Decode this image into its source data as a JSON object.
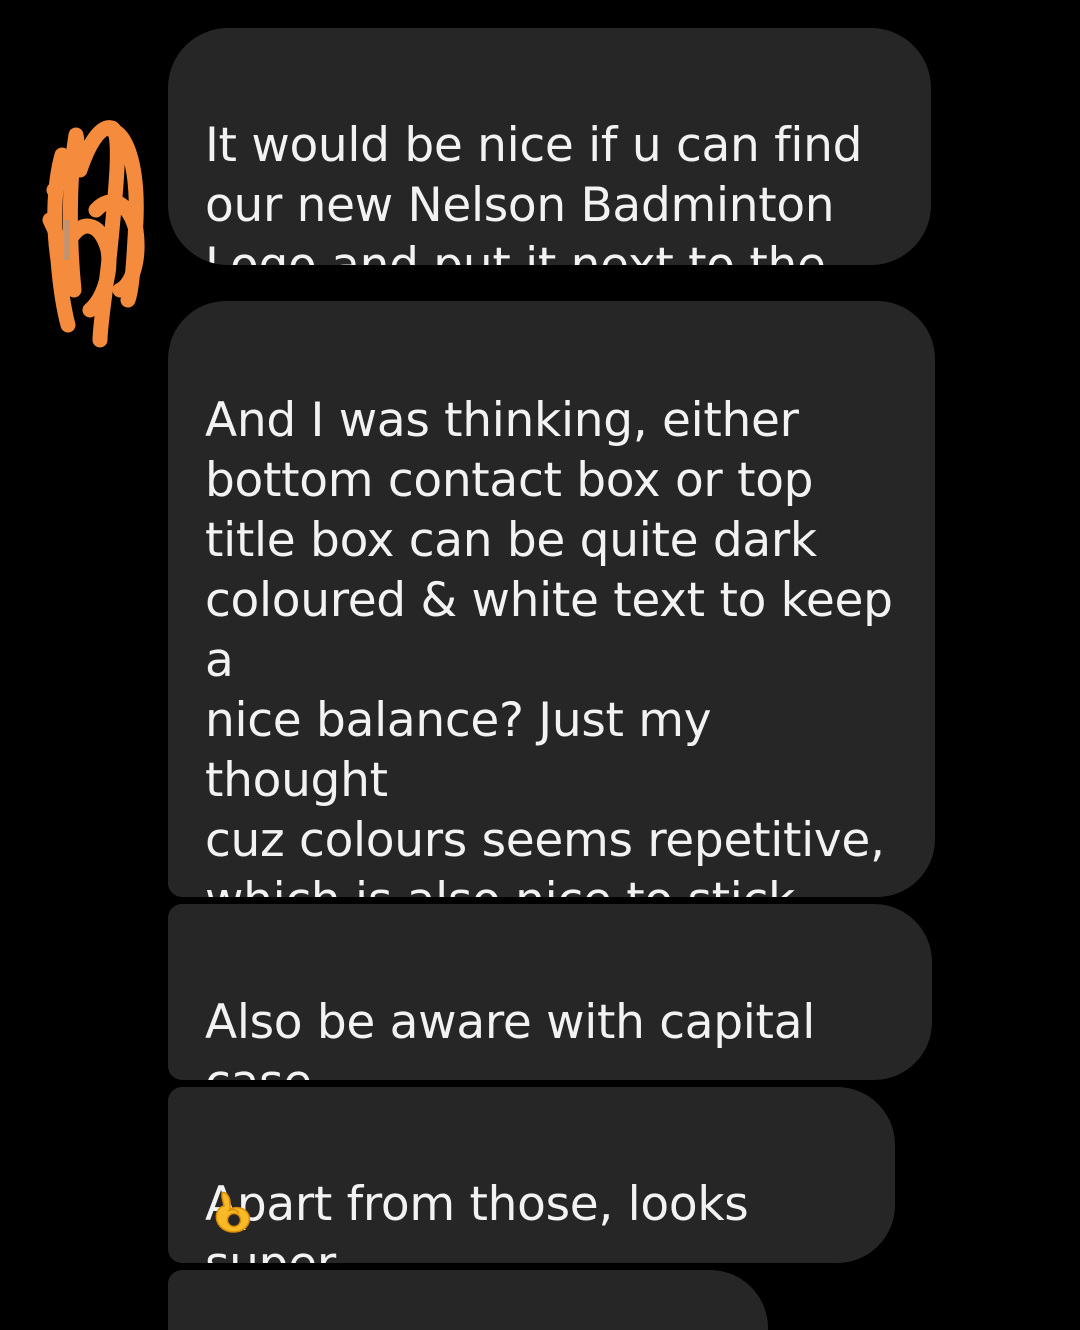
{
  "messages": [
    {
      "text": "It would be nice if u can find\nour new Nelson Badminton\nLogo and put it next to the text"
    },
    {
      "text": "And I was thinking, either\nbottom contact box or top\ntitle box can be quite dark\ncoloured & white text to keep a\nnice balance? Just my thought\ncuz colours seems repetitive,\nwhich is also nice to stick with\nmain colours, but you can try\ndifferent options too"
    },
    {
      "text": "Also be aware with capital case\nfor “Nelson Badminton”"
    },
    {
      "text": "Apart from those, looks super",
      "emoji": "ok-hand-emoji"
    }
  ],
  "colors": {
    "background": "#000000",
    "bubble": "#262626",
    "text": "#f2f2f2",
    "scribble": "#f58b3c",
    "emoji": "#f7b928"
  }
}
